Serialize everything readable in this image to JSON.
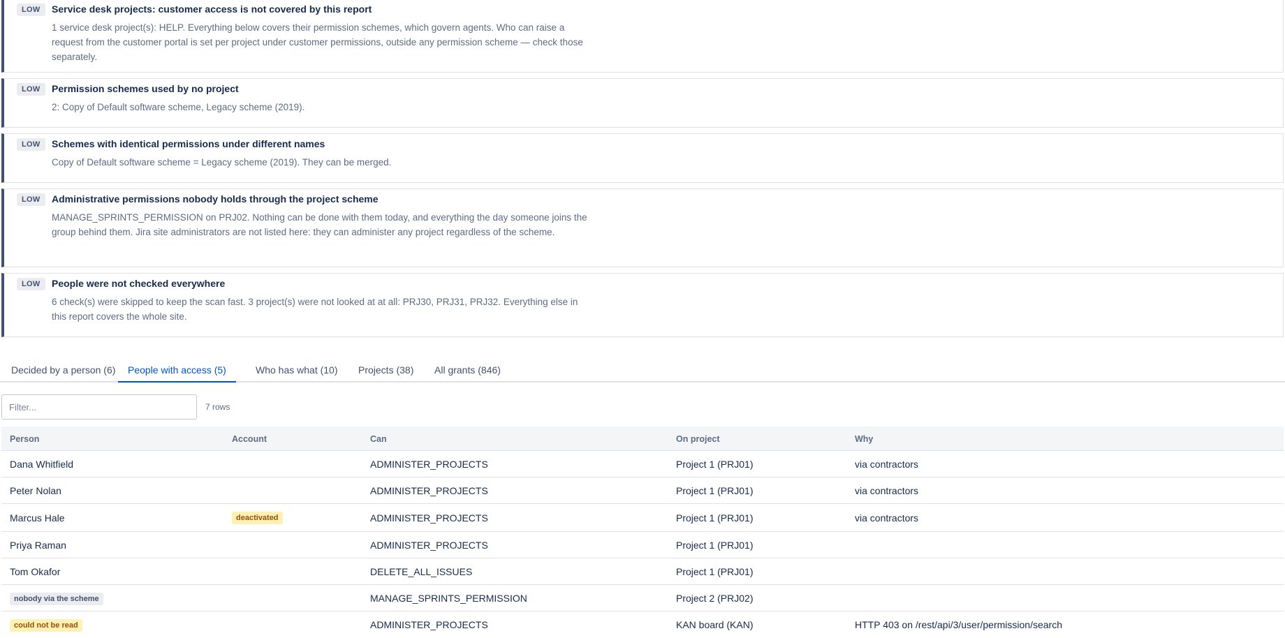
{
  "findings": [
    {
      "severity": "LOW",
      "title": "Service desk projects: customer access is not covered by this report",
      "body": "1 service desk project(s): HELP. Everything below covers their permission schemes, which govern agents. Who can raise a request from the customer portal is set per project under customer permissions, outside any permission scheme — check those separately."
    },
    {
      "severity": "LOW",
      "title": "Permission schemes used by no project",
      "body": "2: Copy of Default software scheme, Legacy scheme (2019)."
    },
    {
      "severity": "LOW",
      "title": "Schemes with identical permissions under different names",
      "body": "Copy of Default software scheme = Legacy scheme (2019). They can be merged."
    },
    {
      "severity": "LOW",
      "title": "Administrative permissions nobody holds through the project scheme",
      "body": "MANAGE_SPRINTS_PERMISSION on PRJ02. Nothing can be done with them today, and everything the day someone joins the group behind them. Jira site administrators are not listed here: they can administer any project regardless of the scheme."
    },
    {
      "severity": "LOW",
      "title": "People were not checked everywhere",
      "body": "6 check(s) were skipped to keep the scan fast. 3 project(s) were not looked at at all: PRJ30, PRJ31, PRJ32. Everything else in this report covers the whole site."
    }
  ],
  "tabs": [
    {
      "label": "Decided by a person (6)",
      "active": false
    },
    {
      "label": "People with access (5)",
      "active": true
    },
    {
      "label": "Who has what (10)",
      "active": false
    },
    {
      "label": "Projects (38)",
      "active": false
    },
    {
      "label": "All grants (846)",
      "active": false
    }
  ],
  "filter": {
    "placeholder": "Filter...",
    "value": ""
  },
  "row_count": "7 rows",
  "table": {
    "columns": [
      "Person",
      "Account",
      "Can",
      "On project",
      "Why"
    ],
    "rows": [
      {
        "person": "Dana Whitfield",
        "person_tag": "",
        "account": "",
        "can": "ADMINISTER_PROJECTS",
        "project": "Project 1 (PRJ01)",
        "why": "via contractors"
      },
      {
        "person": "Peter Nolan",
        "person_tag": "",
        "account": "",
        "can": "ADMINISTER_PROJECTS",
        "project": "Project 1 (PRJ01)",
        "why": "via contractors"
      },
      {
        "person": "Marcus Hale",
        "person_tag": "",
        "account": "deactivated",
        "can": "ADMINISTER_PROJECTS",
        "project": "Project 1 (PRJ01)",
        "why": "via contractors"
      },
      {
        "person": "Priya Raman",
        "person_tag": "",
        "account": "",
        "can": "ADMINISTER_PROJECTS",
        "project": "Project 1 (PRJ01)",
        "why": ""
      },
      {
        "person": "Tom Okafor",
        "person_tag": "",
        "account": "",
        "can": "DELETE_ALL_ISSUES",
        "project": "Project 1 (PRJ01)",
        "why": ""
      },
      {
        "person": "",
        "person_tag": "nobody via the scheme",
        "account": "",
        "can": "MANAGE_SPRINTS_PERMISSION",
        "project": "Project 2 (PRJ02)",
        "why": ""
      },
      {
        "person": "",
        "person_tag": "could not be read",
        "account": "",
        "can": "ADMINISTER_PROJECTS",
        "project": "KAN board (KAN)",
        "why": "HTTP 403 on /rest/api/3/user/permission/search"
      }
    ]
  }
}
